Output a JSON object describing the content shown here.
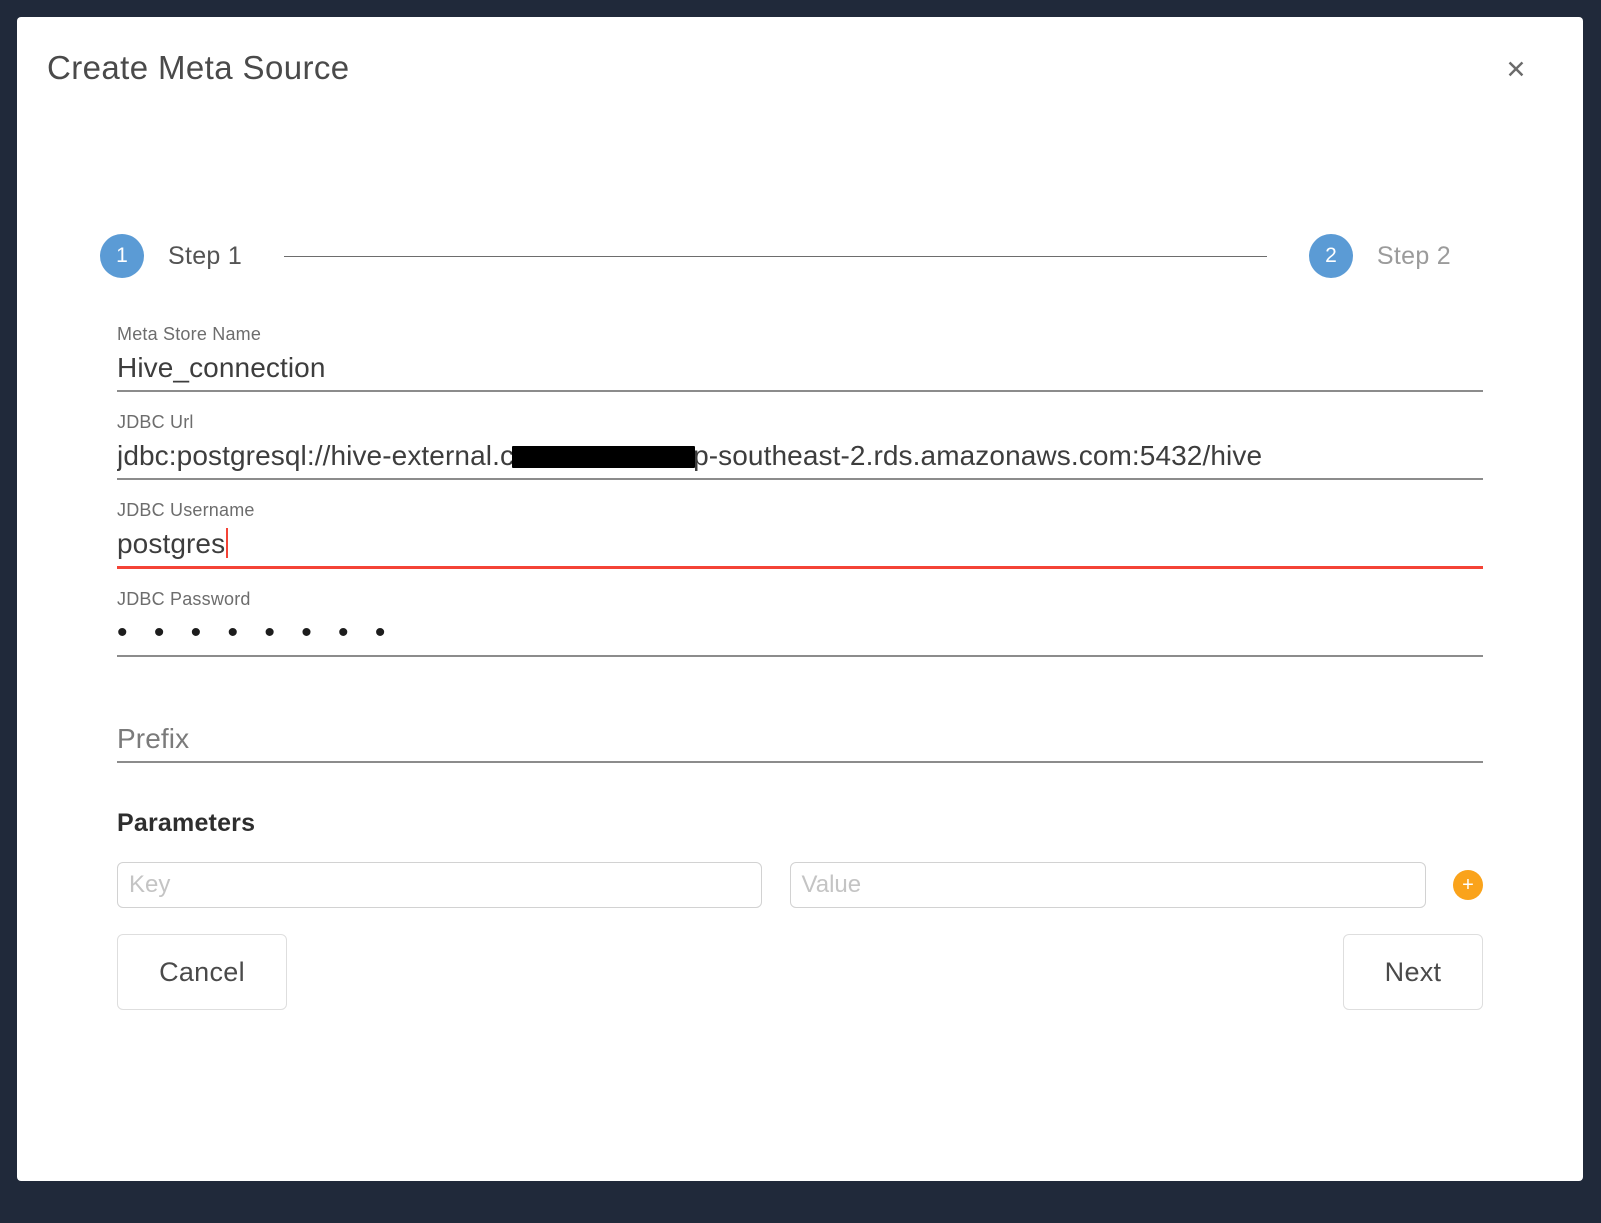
{
  "dialog": {
    "title": "Create Meta Source",
    "close_icon": "close-icon"
  },
  "stepper": {
    "steps": [
      {
        "number": "1",
        "label": "Step 1",
        "state": "active"
      },
      {
        "number": "2",
        "label": "Step 2",
        "state": "inactive"
      }
    ],
    "accent_color": "#5b9bd5"
  },
  "form": {
    "fields": [
      {
        "label": "Meta Store Name",
        "value": "Hive_connection"
      },
      {
        "label": "JDBC Url",
        "value_before_redaction": "jdbc:postgresql://hive-external.c",
        "value_after_redaction": "p-southeast-2.rds.amazonaws.com:5432/hive"
      },
      {
        "label": "JDBC Username",
        "value": "postgres"
      },
      {
        "label": "JDBC Password",
        "value": "• • • • • • • •"
      }
    ],
    "prefix": {
      "placeholder": "Prefix",
      "value": ""
    },
    "error_color": "#f44336"
  },
  "parameters": {
    "heading": "Parameters",
    "key_placeholder": "Key",
    "key_value": "",
    "value_placeholder": "Value",
    "value_value": "",
    "add_icon": "plus-icon",
    "add_label": "+",
    "add_color": "#faa31b"
  },
  "footer": {
    "cancel_label": "Cancel",
    "next_label": "Next"
  }
}
